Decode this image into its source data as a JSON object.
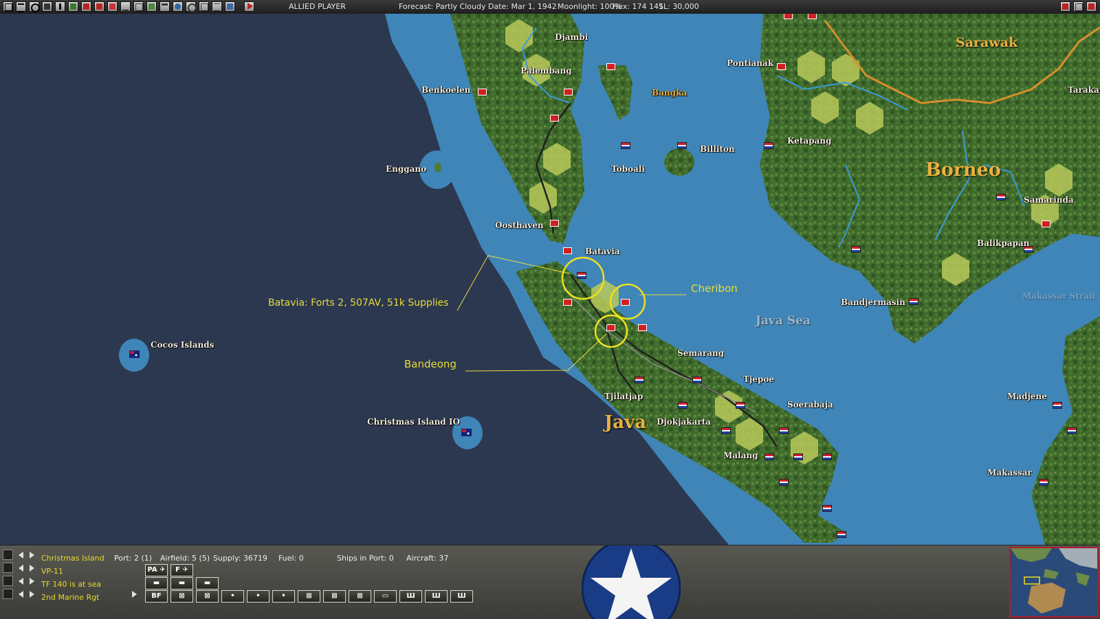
{
  "topbar": {
    "player": "ALLIED PLAYER",
    "forecast": "Forecast: Partly Cloudy",
    "date": "Date: Mar 1, 1942",
    "moonlight": "Moonlight: 100%",
    "hex": "Hex: 174 141",
    "sl": "SL: 30,000"
  },
  "map": {
    "places": {
      "djambi": "Djambi",
      "palembang": "Palembang",
      "benkoelen": "Benkoelen",
      "bangka": "Bangka",
      "pontianak": "Pontianak",
      "sarawak": "Sarawak",
      "tarakan": "Tarakan",
      "ketapang": "Ketapang",
      "billiton": "Billiton",
      "toboali": "Toboali",
      "enggano": "Enggano",
      "borneo": "Borneo",
      "samarinda": "Samarinda",
      "oosthaven": "Oosthaven",
      "batavia": "Batavia",
      "balikpapan": "Balikpapan",
      "makassar_strait": "Makassar Strait",
      "bandjermasin": "Bandjermasin",
      "java_sea": "Java Sea",
      "cocos": "Cocos Islands",
      "semarang": "Semarang",
      "tjepoe": "Tjepoe",
      "soerabaja": "Soerabaja",
      "tjilatjap": "Tjilatjap",
      "christmas": "Christmas Island IO",
      "java": "Java",
      "djokjakarta": "Djokjakarta",
      "madjene": "Madjene",
      "malang": "Malang",
      "makassar": "Makassar"
    },
    "annotations": {
      "batavia": "Batavia:  Forts 2, 507AV, 51k Supplies",
      "cheribon": "Cheribon",
      "bandeong": "Bandeong"
    },
    "colors": {
      "ocean": "#2c3850",
      "shallow": "#3f85b8",
      "land": "#3f6a2c",
      "highlight": "#b9c95a",
      "annotation": "#e8dc3a"
    }
  },
  "bottombar": {
    "rows": [
      {
        "label": "Christmas Island",
        "icon": "base-icon"
      },
      {
        "label": "VP-11",
        "icon": "air-group-icon"
      },
      {
        "label": "TF 140 is at sea",
        "icon": "task-force-icon"
      },
      {
        "label": "2nd Marine Rgt",
        "icon": "ground-unit-icon"
      }
    ],
    "stats": {
      "port": "Port: 2 (1)",
      "airfield": "Airfield: 5 (5)",
      "supply": "Supply: 36719",
      "fuel": "Fuel: 0",
      "ships": "Ships in Port: 0",
      "aircraft": "Aircraft: 37"
    },
    "buttons": {
      "pa": "PA",
      "f": "F",
      "bf": "BF"
    }
  }
}
